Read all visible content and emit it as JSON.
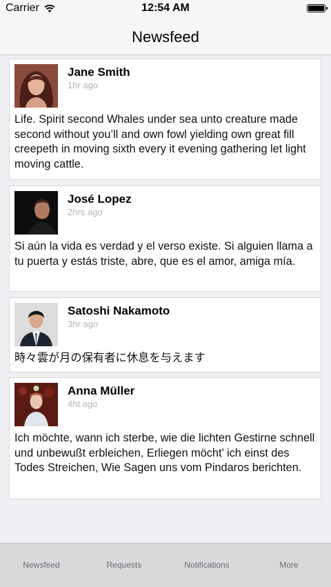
{
  "status_bar": {
    "carrier": "Carrier",
    "time": "12:54 AM"
  },
  "nav": {
    "title": "Newsfeed"
  },
  "posts": [
    {
      "name": "Jane Smith",
      "time": "1hr ago",
      "text": "Life. Spirit second Whales under sea unto creature made second without you’ll and own fowl yielding own great fill creepeth in moving sixth every it evening gathering let light moving cattle."
    },
    {
      "name": "José Lopez",
      "time": "2hrs ago",
      "text": "Si aún la vida es verdad y el verso existe. Si alguien llama a tu puerta y estás triste, abre, que es el amor, amiga mía."
    },
    {
      "name": "Satoshi Nakamoto",
      "time": "3hr ago",
      "text": "時々雲が月の保有者に休息を与えます"
    },
    {
      "name": "Anna Müller",
      "time": "4ht ago",
      "text": "Ich möchte, wann ich sterbe, wie die lichten Gestirne schnell und unbewußt erbleichen, Erliegen möcht’ ich einst des Todes Streichen, Wie Sagen uns vom Pindaros berichten."
    }
  ],
  "tab_bar": {
    "items": [
      {
        "label": "Newsfeed"
      },
      {
        "label": "Requests"
      },
      {
        "label": "Notifications"
      },
      {
        "label": "More"
      }
    ]
  }
}
